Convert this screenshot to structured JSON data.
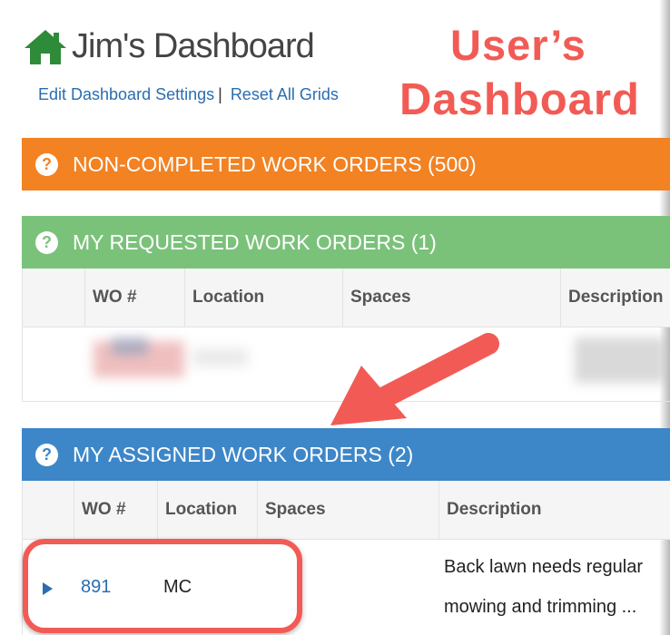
{
  "header": {
    "title": "Jim's Dashboard",
    "edit_link": "Edit Dashboard Settings",
    "separator": "|",
    "reset_link": "Reset All Grids",
    "icon": "home-icon"
  },
  "annotation": {
    "line1": "User’s",
    "line2": "Dashboard",
    "color": "#f25b55"
  },
  "panels": {
    "non_completed": {
      "title": "NON-COMPLETED WORK ORDERS (500)",
      "color": "#f28222"
    },
    "requested": {
      "title": "MY REQUESTED WORK ORDERS (1)",
      "color": "#7ac27a",
      "columns": [
        "WO #",
        "Location",
        "Spaces",
        "Description"
      ]
    },
    "assigned": {
      "title": "MY ASSIGNED WORK ORDERS (2)",
      "color": "#3d87c9",
      "columns": [
        "WO #",
        "Location",
        "Spaces",
        "Description"
      ],
      "rows": [
        {
          "wo": "891",
          "location": "MC",
          "spaces": "",
          "description_line1": "Back lawn needs regular",
          "description_line2": "mowing and trimming ..."
        }
      ]
    }
  },
  "help_icon_glyph": "?"
}
